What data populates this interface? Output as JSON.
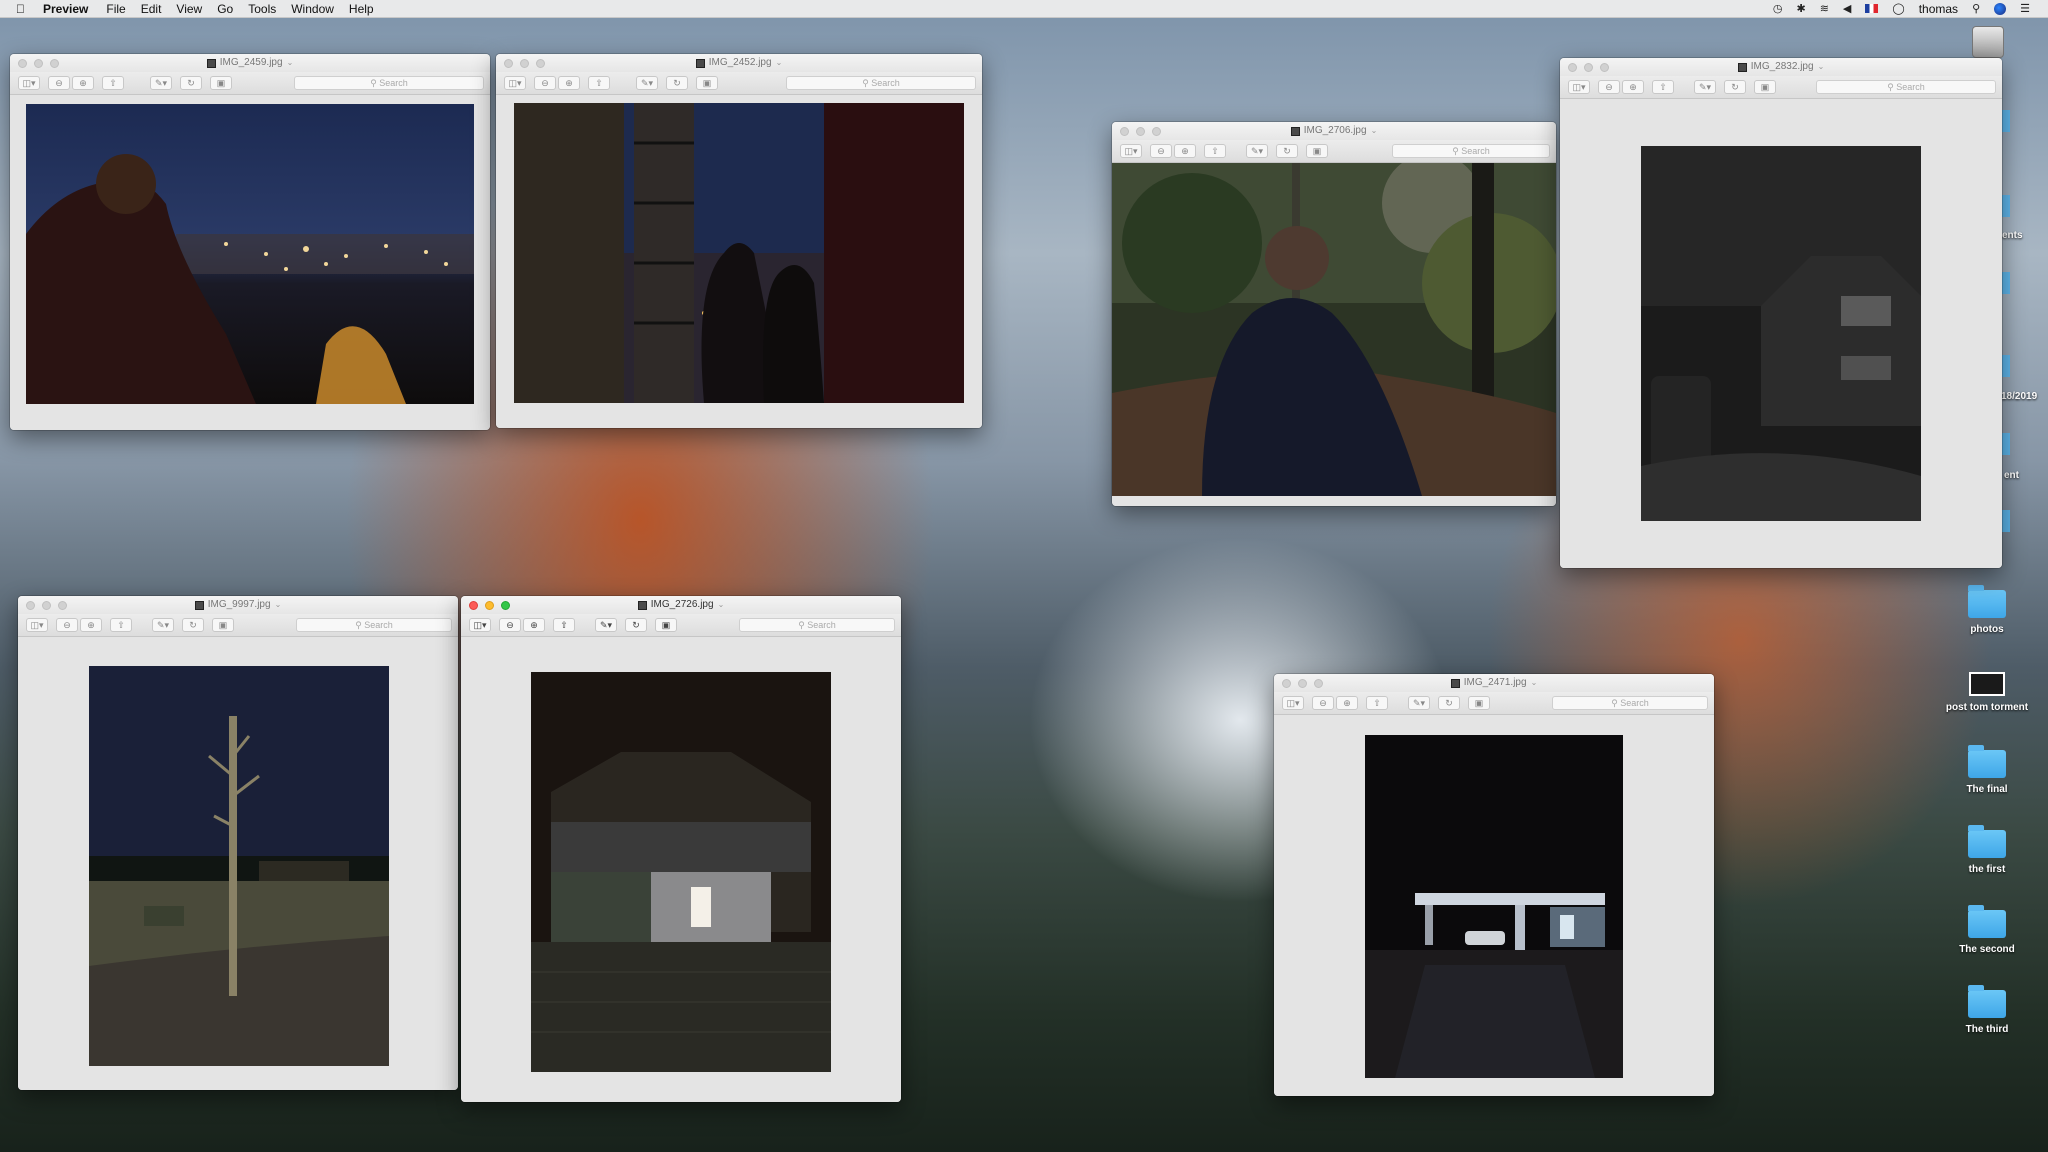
{
  "menubar": {
    "app_name": "Preview",
    "menus": [
      "File",
      "Edit",
      "View",
      "Go",
      "Tools",
      "Window",
      "Help"
    ],
    "user": "thomas"
  },
  "windows": [
    {
      "title": "IMG_2459.jpg",
      "search_placeholder": "Search"
    },
    {
      "title": "IMG_2452.jpg",
      "search_placeholder": "Search"
    },
    {
      "title": "IMG_2706.jpg",
      "search_placeholder": "Search"
    },
    {
      "title": "IMG_2832.jpg",
      "search_placeholder": "Search"
    },
    {
      "title": "IMG_9997.jpg",
      "search_placeholder": "Search"
    },
    {
      "title": "IMG_2726.jpg",
      "search_placeholder": "Search"
    },
    {
      "title": "IMG_2471.jpg",
      "search_placeholder": "Search"
    }
  ],
  "desktop": {
    "items": [
      "photos",
      "post tom torment",
      "The final",
      "the first",
      "The second",
      "The third"
    ],
    "edge_labels": [
      "ents",
      "18/2019",
      "ent"
    ]
  },
  "colors": {
    "close": "#fc5b57",
    "minimize": "#fdbc2e",
    "maximize": "#33c748",
    "folder": "#4fb3ef"
  }
}
